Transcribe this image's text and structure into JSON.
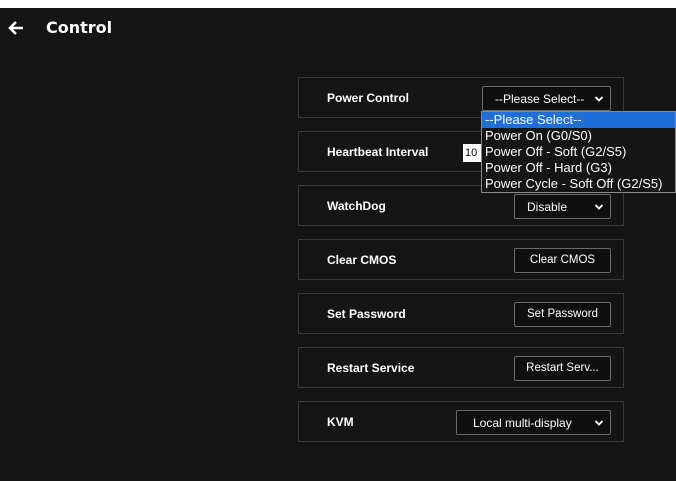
{
  "header": {
    "title": "Control"
  },
  "rows": {
    "power": {
      "label": "Power Control",
      "select_value": "--Please Select--"
    },
    "heartbeat": {
      "label": "Heartbeat Interval",
      "input_value": "10"
    },
    "watchdog": {
      "label": "WatchDog",
      "select_value": "Disable"
    },
    "cmos": {
      "label": "Clear CMOS",
      "button": "Clear CMOS"
    },
    "password": {
      "label": "Set Password",
      "button": "Set Password"
    },
    "restart": {
      "label": "Restart Service",
      "button": "Restart Serv..."
    },
    "kvm": {
      "label": "KVM",
      "select_value": "Local multi-display"
    }
  },
  "dropdown": {
    "options": [
      "--Please Select--",
      "Power On (G0/S0)",
      "Power Off - Soft (G2/S5)",
      "Power Off - Hard (G3)",
      "Power Cycle - Soft Off (G2/S5)"
    ],
    "selected_index": 0
  },
  "colors": {
    "background": "#151515",
    "highlight": "#1e6fd9"
  },
  "icons": {
    "back": "arrow-left-icon",
    "chevron": "chevron-down-icon"
  }
}
